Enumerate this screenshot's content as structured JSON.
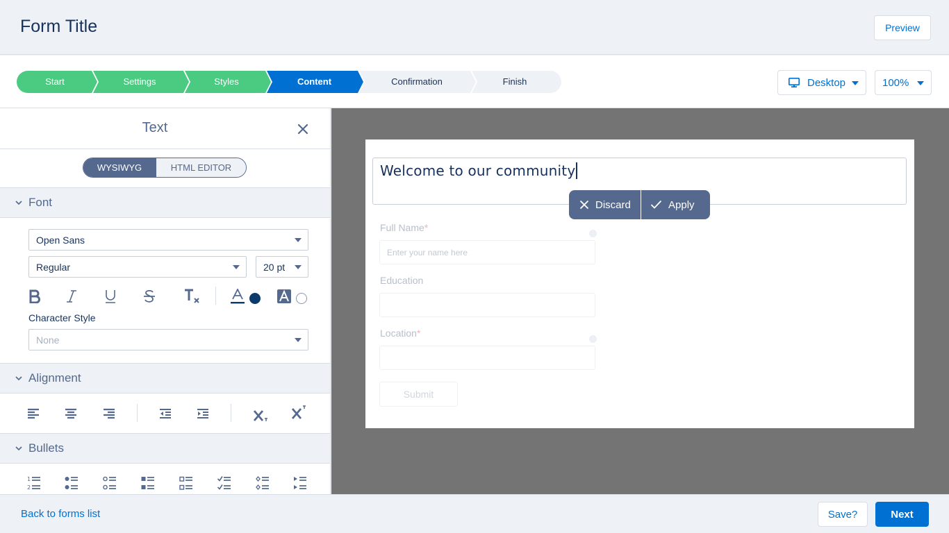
{
  "header": {
    "title": "Form Title",
    "preview_label": "Preview"
  },
  "steps": [
    {
      "label": "Start",
      "state": "done"
    },
    {
      "label": "Settings",
      "state": "done"
    },
    {
      "label": "Styles",
      "state": "done"
    },
    {
      "label": "Content",
      "state": "current"
    },
    {
      "label": "Confirmation",
      "state": "todo"
    },
    {
      "label": "Finish",
      "state": "todo"
    }
  ],
  "toolbar": {
    "device": "Desktop",
    "device_icon": "monitor-icon",
    "zoom": "100%"
  },
  "panel": {
    "title": "Text",
    "close_icon": "close-icon",
    "mode_toggle": {
      "active": "WYSIWYG",
      "inactive": "HTML EDITOR"
    },
    "font_section": {
      "title": "Font",
      "font_family": "Open Sans",
      "font_weight": "Regular",
      "font_size": "20 pt",
      "format_icons": [
        "bold-icon",
        "italic-icon",
        "underline-icon",
        "strikethrough-icon",
        "clear-format-icon",
        "font-color-icon",
        "highlight-color-icon"
      ],
      "text_color": "#0b3a6b",
      "highlight_color": "#ffffff",
      "character_style_label": "Character Style",
      "character_style_placeholder": "None"
    },
    "alignment_section": {
      "title": "Alignment",
      "icons": [
        "align-left-icon",
        "align-center-icon",
        "align-right-icon",
        "outdent-icon",
        "indent-icon",
        "subscript-icon",
        "superscript-icon"
      ]
    },
    "bullets_section": {
      "title": "Bullets",
      "icons": [
        "numbered-list-icon",
        "bullet-list-filled-icon",
        "bullet-list-hollow-icon",
        "square-list-filled-icon",
        "square-list-hollow-icon",
        "check-list-icon",
        "diamond-list-icon",
        "arrow-list-icon"
      ]
    }
  },
  "canvas": {
    "editor_text": "Welcome to our community",
    "discard_label": "Discard",
    "apply_label": "Apply",
    "fields": [
      {
        "label": "Full Name",
        "required": "*",
        "placeholder": "Enter your name here"
      },
      {
        "label": "Education",
        "required": "",
        "placeholder": ""
      },
      {
        "label": "Location",
        "required": "*",
        "placeholder": ""
      }
    ],
    "submit_label": "Submit"
  },
  "footer": {
    "back_label": "Back to forms list",
    "save_label": "Save?",
    "next_label": "Next"
  },
  "colors": {
    "step_done": "#4bca81",
    "step_current": "#0070d2",
    "step_todo": "#eef1f6",
    "brand": "#0070d2",
    "panel_accent": "#54698d"
  }
}
